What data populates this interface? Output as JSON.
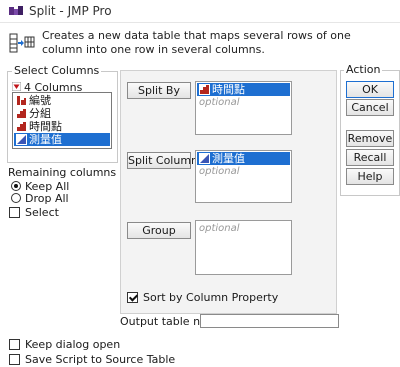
{
  "window": {
    "title": "Split - JMP Pro"
  },
  "description": "Creates a new data table that maps several rows of one column into one row in several columns.",
  "select_columns": {
    "label": "Select Columns",
    "count_label": "4 Columns",
    "items": [
      {
        "label": "編號",
        "type": "nominal",
        "selected": false
      },
      {
        "label": "分組",
        "type": "ordinal",
        "selected": false
      },
      {
        "label": "時間點",
        "type": "ordinal",
        "selected": false
      },
      {
        "label": "測量值",
        "type": "continuous",
        "selected": true
      }
    ]
  },
  "remaining_columns": {
    "label": "Remaining columns",
    "options": [
      {
        "label": "Keep All",
        "checked": true
      },
      {
        "label": "Drop All",
        "checked": false
      }
    ],
    "select_label": "Select"
  },
  "roles": {
    "split_by": {
      "button": "Split By",
      "value": "時間點",
      "placeholder": "optional"
    },
    "split_columns": {
      "button": "Split Columns",
      "value": "測量值",
      "placeholder": "optional"
    },
    "group": {
      "button": "Group",
      "placeholder": "optional"
    },
    "sort_by_property": {
      "label": "Sort by Column Property",
      "checked": true
    }
  },
  "output_table": {
    "label": "Output table name:",
    "value": ""
  },
  "action": {
    "label": "Action",
    "buttons": {
      "ok": "OK",
      "cancel": "Cancel",
      "remove": "Remove",
      "recall": "Recall",
      "help": "Help"
    }
  },
  "footer": {
    "keep_open": {
      "label": "Keep dialog open",
      "checked": false
    },
    "save_script": {
      "label": "Save Script to Source Table",
      "checked": false
    }
  },
  "colors": {
    "accent": "#1e6fd1",
    "continuous_icon": "#3a55b5",
    "ordinal_icon": "#b3261e",
    "nominal_icon": "#b3261e"
  }
}
